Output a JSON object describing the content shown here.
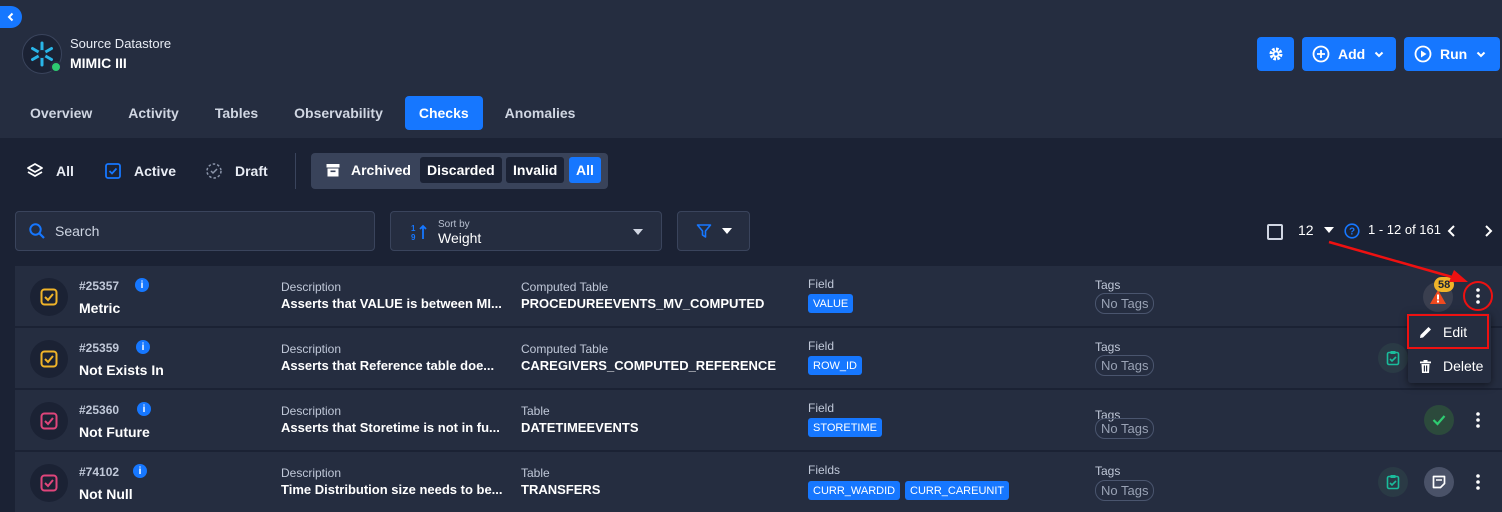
{
  "datastore": {
    "label": "Source Datastore",
    "name": "MIMIC III"
  },
  "actions": {
    "add_label": "Add",
    "run_label": "Run"
  },
  "tabs": [
    "Overview",
    "Activity",
    "Tables",
    "Observability",
    "Checks",
    "Anomalies"
  ],
  "active_tab": "Checks",
  "check_filters": {
    "all": "All",
    "active": "Active",
    "draft": "Draft"
  },
  "status_filters": {
    "archived": "Archived",
    "discarded": "Discarded",
    "invalid": "Invalid",
    "all": "All"
  },
  "search": {
    "placeholder": "Search"
  },
  "sort": {
    "label": "Sort by",
    "value": "Weight"
  },
  "pagination": {
    "page_size": "12",
    "range": "1 - 12 of 161"
  },
  "rows": [
    {
      "id": "#25357",
      "type": "Metric",
      "description_label": "Description",
      "description": "Asserts that VALUE is between MI...",
      "table_label": "Computed Table",
      "table": "PROCEDUREEVENTS_MV_COMPUTED",
      "field_label": "Field",
      "fields": [
        "VALUE"
      ],
      "tags_label": "Tags",
      "tags": "No Tags",
      "anomaly_count": "58"
    },
    {
      "id": "#25359",
      "type": "Not Exists In",
      "description_label": "Description",
      "description": "Asserts that Reference table doe...",
      "table_label": "Computed Table",
      "table": "CAREGIVERS_COMPUTED_REFERENCE",
      "field_label": "Field",
      "fields": [
        "ROW_ID"
      ],
      "tags_label": "Tags",
      "tags": "No Tags"
    },
    {
      "id": "#25360",
      "type": "Not Future",
      "description_label": "Description",
      "description": "Asserts that Storetime is not in fu...",
      "table_label": "Table",
      "table": "DATETIMEEVENTS",
      "field_label": "Field",
      "fields": [
        "STORETIME"
      ],
      "tags_label": "Tags",
      "tags": "No Tags"
    },
    {
      "id": "#74102",
      "type": "Not Null",
      "description_label": "Description",
      "description": "Time Distribution size needs to be...",
      "table_label": "Table",
      "table": "TRANSFERS",
      "field_label": "Fields",
      "fields": [
        "CURR_WARDID",
        "CURR_CAREUNIT"
      ],
      "tags_label": "Tags",
      "tags": "No Tags"
    }
  ],
  "context_menu": {
    "edit": "Edit",
    "delete": "Delete"
  },
  "colors": {
    "accent": "#1677ff",
    "background": "#1b2234",
    "panel": "#252d40",
    "metric_icon": "#f0b429",
    "check_icon": "#e0457b",
    "success": "#2ecc71",
    "highlight": "#e11111"
  }
}
